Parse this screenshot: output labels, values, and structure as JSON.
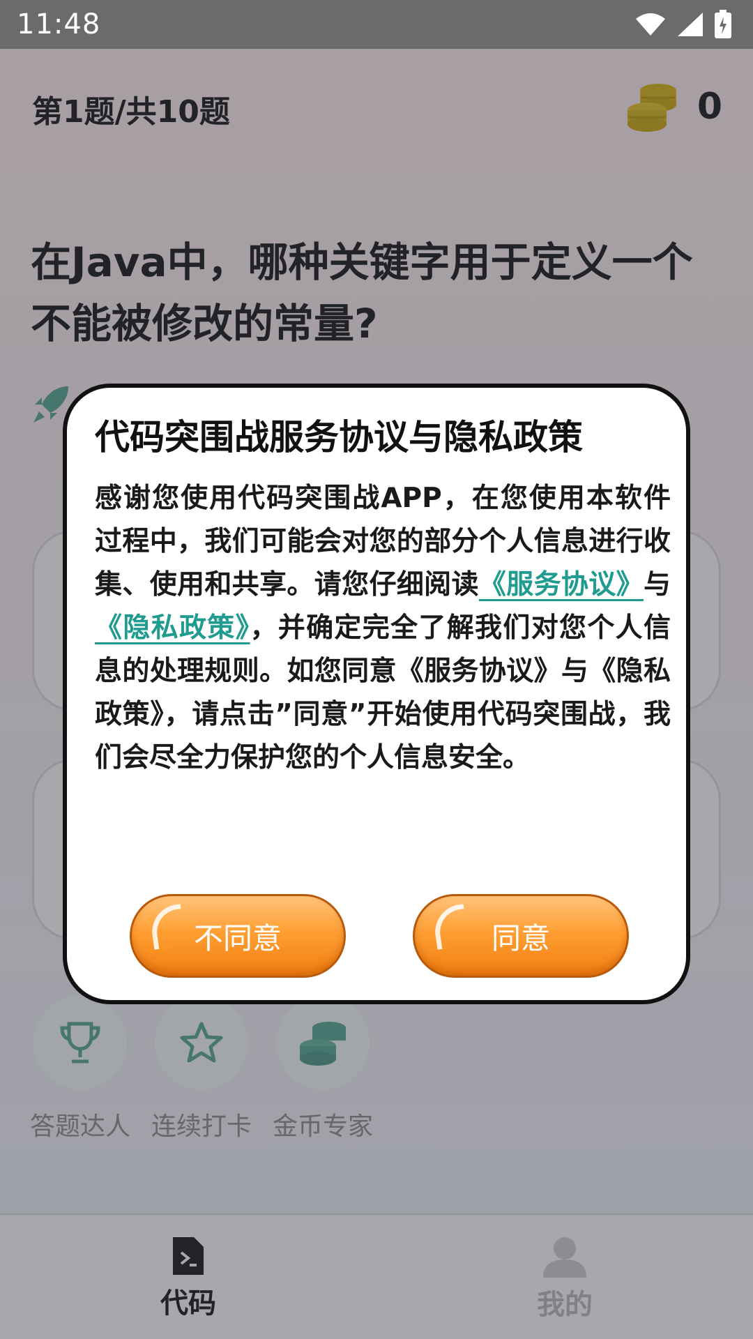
{
  "status_bar": {
    "time": "11:48"
  },
  "header": {
    "progress": "第1题/共10题",
    "coin_count": "0"
  },
  "question": {
    "text": "在Java中，哪种关键字用于定义一个不能被修改的常量?"
  },
  "badges": [
    {
      "label": "答题达人",
      "icon": "trophy-icon"
    },
    {
      "label": "连续打卡",
      "icon": "star-icon"
    },
    {
      "label": "金币专家",
      "icon": "coins-icon"
    }
  ],
  "bottom_nav": {
    "code_label": "代码",
    "mine_label": "我的"
  },
  "dialog": {
    "title": "代码突围战服务协议与隐私政策",
    "body_part1": "感谢您使用代码突围战APP，在您使用本软件过程中，我们可能会对您的部分个人信息进行收集、使用和共享。请您仔细阅读",
    "service_link": "《服务协议》",
    "connector": "与",
    "privacy_link": "《隐私政策》",
    "body_part2": "，并确定完全了解我们对您个人信息的处理规则。如您同意《服务协议》与《隐私政策》，请点击”同意”开始使用代码突围战，我们会尽全力保护您的个人信息安全。",
    "reject_label": "不同意",
    "agree_label": "同意"
  },
  "colors": {
    "link": "#1f9c8f",
    "button_orange": "#ff9f33",
    "coin_gold": "#d4b21c",
    "badge_icon": "#5aa38f"
  }
}
